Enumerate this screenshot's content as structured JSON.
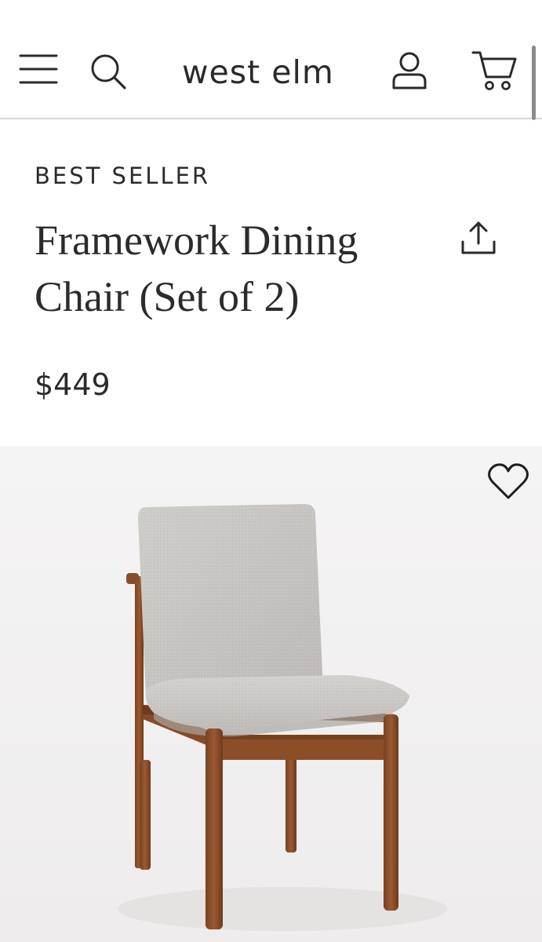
{
  "header": {
    "logo_text": "west elm",
    "menu_icon": "hamburger-menu-icon",
    "search_icon": "search-icon",
    "account_icon": "user-account-icon",
    "cart_icon": "shopping-cart-icon"
  },
  "product": {
    "badge": "BEST SELLER",
    "title": "Framework Dining Chair (Set of 2)",
    "price": "$449",
    "share_icon": "share-upload-icon",
    "wishlist_icon": "heart-icon",
    "image_description": "framework-dining-chair-photo"
  },
  "colors": {
    "text": "#2b2b2b",
    "divider": "#d6d6d6",
    "image_background": "#f4f3f3",
    "upholstery": "#c9c7c4",
    "wood": "#8a4f2a"
  }
}
